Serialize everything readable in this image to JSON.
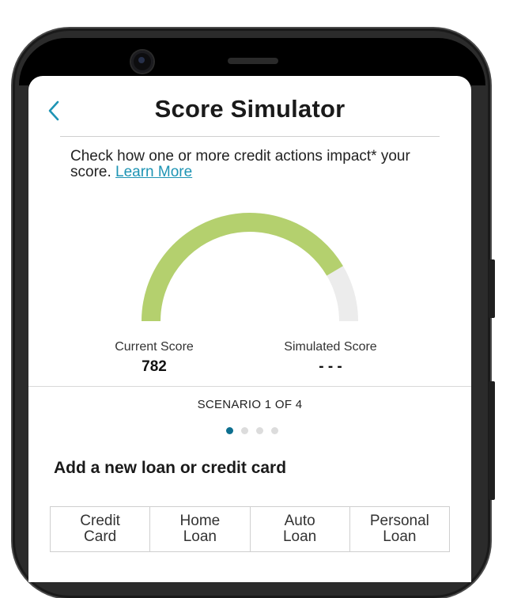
{
  "header": {
    "title": "Score Simulator",
    "back_icon": "chevron-left-icon"
  },
  "intro": {
    "text": "Check how one or more credit actions impact* your score.",
    "link_label": "Learn More"
  },
  "gauge": {
    "current_score": 782,
    "fill_fraction": 0.83,
    "fill_color": "#b4d06e",
    "track_color": "#ececec",
    "needle_color": "#3a3a3a"
  },
  "scores": {
    "current_label": "Current Score",
    "current_value": "782",
    "simulated_label": "Simulated Score",
    "simulated_value": "- - -"
  },
  "scenario": {
    "label": "SCENARIO 1 OF 4",
    "total": 4,
    "active_index": 0
  },
  "section": {
    "heading": "Add a new loan or credit card"
  },
  "options": [
    "Credit\nCard",
    "Home\nLoan",
    "Auto\nLoan",
    "Personal\nLoan"
  ],
  "colors": {
    "accent": "#1e94b4",
    "dot_active": "#0d6f8f"
  }
}
